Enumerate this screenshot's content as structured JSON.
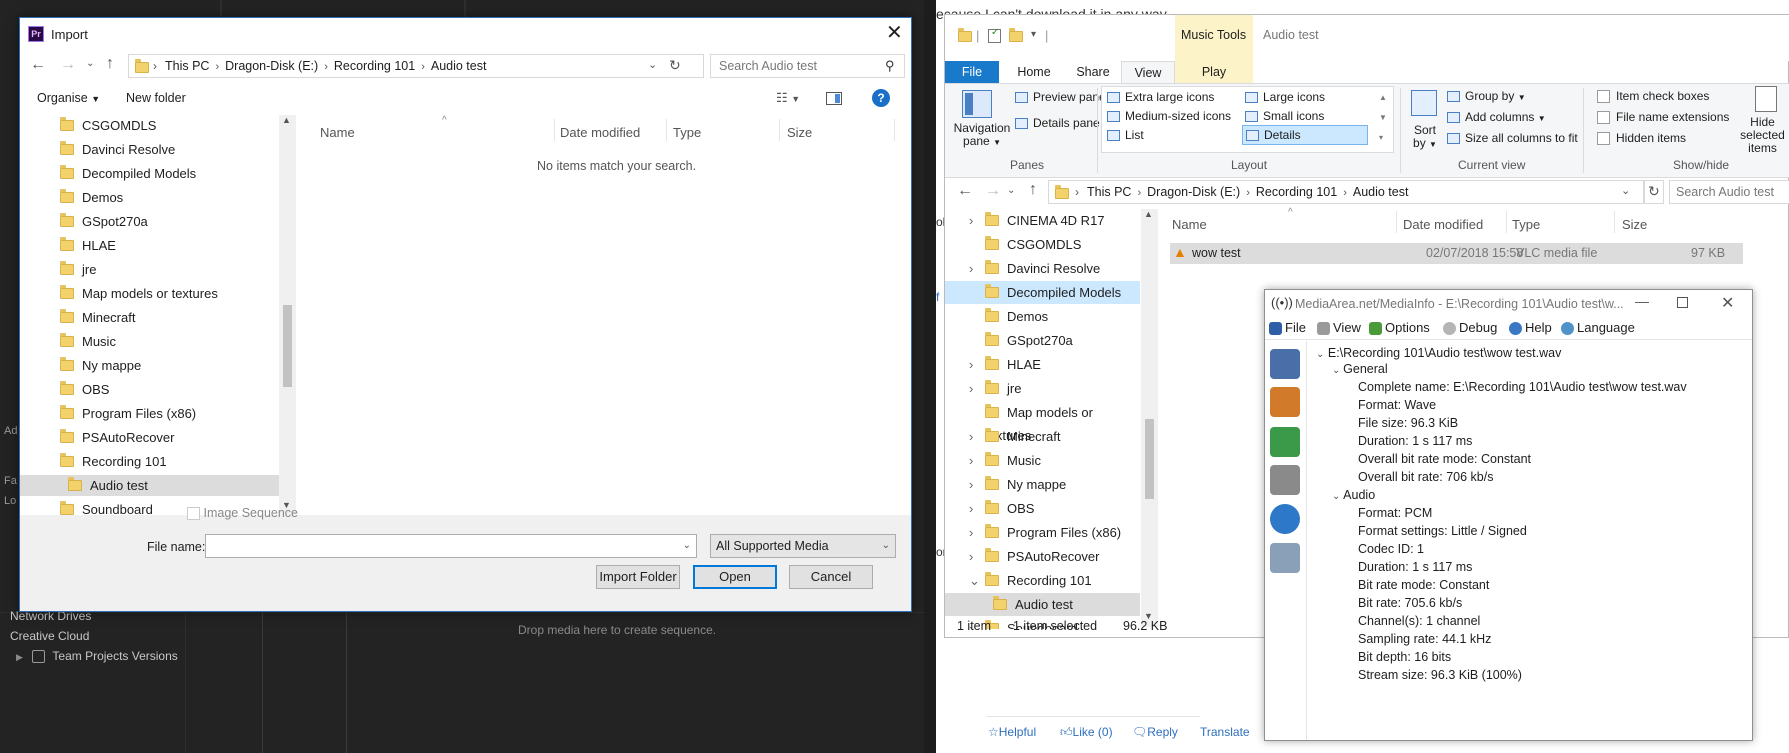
{
  "premiere": {
    "sidebar_items": [
      "Network Drives",
      "Creative Cloud",
      "Team Projects Versions"
    ],
    "drop_hint": "Drop media here to create sequence.",
    "left_fragments": [
      "Fa",
      "Lo",
      "Ad"
    ]
  },
  "web": {
    "header_fragment": "ecause I can't download it in any way",
    "actions": {
      "helpful": "Helpful",
      "like": "Like (0)",
      "reply": "Reply",
      "translate": "Translate"
    },
    "left_fragments": [
      "ol",
      "f",
      "or"
    ]
  },
  "import_dialog": {
    "title": "Import",
    "logo": "Pr",
    "breadcrumb": [
      "This PC",
      "Dragon-Disk (E:)",
      "Recording 101",
      "Audio test"
    ],
    "search_placeholder": "Search Audio test",
    "toolbar": {
      "organise": "Organise",
      "new_folder": "New folder",
      "help": "?"
    },
    "folders": [
      "CSGOMDLS",
      "Davinci Resolve",
      "Decompiled Models",
      "Demos",
      "GSpot270a",
      "HLAE",
      "jre",
      "Map models or textures",
      "Minecraft",
      "Music",
      "Ny mappe",
      "OBS",
      "Program Files (x86)",
      "PSAutoRecover",
      "Recording 101",
      "Audio test",
      "Soundboard"
    ],
    "selected_folder": "Audio test",
    "columns": [
      "Name",
      "Date modified",
      "Type",
      "Size"
    ],
    "empty_message": "No items match your search.",
    "image_sequence_label": "Image Sequence",
    "file_name_label": "File name:",
    "file_name_value": "",
    "file_type": "All Supported Media",
    "buttons": {
      "import_folder": "Import Folder",
      "open": "Open",
      "cancel": "Cancel"
    }
  },
  "explorer": {
    "context_tab": "Music Tools",
    "window_title": "Audio test",
    "tabs": [
      "File",
      "Home",
      "Share",
      "View",
      "Play"
    ],
    "active_tab": "View",
    "ribbon": {
      "panes": {
        "navigation_pane": "Navigation pane",
        "preview_pane": "Preview pane",
        "details_pane": "Details pane",
        "group": "Panes"
      },
      "layout": {
        "items": [
          "Extra large icons",
          "Large icons",
          "Medium-sized icons",
          "Small icons",
          "List",
          "Details"
        ],
        "selected": "Details",
        "group": "Layout"
      },
      "current_view": {
        "sort_by": "Sort by",
        "group_by": "Group by",
        "add_columns": "Add columns",
        "size_all": "Size all columns to fit",
        "group": "Current view"
      },
      "show_hide": {
        "item_check_boxes": "Item check boxes",
        "file_name_extensions": "File name extensions",
        "hidden_items": "Hidden items",
        "hide_selected": "Hide selected items",
        "group": "Show/hide"
      }
    },
    "breadcrumb": [
      "This PC",
      "Dragon-Disk (E:)",
      "Recording 101",
      "Audio test"
    ],
    "search_placeholder": "Search Audio test",
    "tree": [
      {
        "label": "CINEMA 4D R17",
        "expandable": true
      },
      {
        "label": "CSGOMDLS",
        "expandable": false
      },
      {
        "label": "Davinci Resolve",
        "expandable": true
      },
      {
        "label": "Decompiled Models",
        "expandable": false
      },
      {
        "label": "Demos",
        "expandable": false
      },
      {
        "label": "GSpot270a",
        "expandable": false
      },
      {
        "label": "HLAE",
        "expandable": true
      },
      {
        "label": "jre",
        "expandable": true
      },
      {
        "label": "Map models or textures",
        "expandable": false
      },
      {
        "label": "Minecraft",
        "expandable": true
      },
      {
        "label": "Music",
        "expandable": true
      },
      {
        "label": "Ny mappe",
        "expandable": true
      },
      {
        "label": "OBS",
        "expandable": true
      },
      {
        "label": "Program Files (x86)",
        "expandable": true
      },
      {
        "label": "PSAutoRecover",
        "expandable": true
      },
      {
        "label": "Recording 101",
        "expandable": true
      },
      {
        "label": "Audio test",
        "expandable": false
      },
      {
        "label": "Soundboard",
        "expandable": true
      }
    ],
    "columns": [
      "Name",
      "Date modified",
      "Type",
      "Size"
    ],
    "files": [
      {
        "name": "wow test",
        "date": "02/07/2018 15:58",
        "type": "VLC media file",
        "size": "97 KB"
      }
    ],
    "status": {
      "count": "1 item",
      "selected": "1 item selected",
      "size": "96.2 KB"
    }
  },
  "mediainfo": {
    "title": "MediaArea.net/MediaInfo - E:\\Recording 101\\Audio test\\w...",
    "menu": [
      "File",
      "View",
      "Options",
      "Debug",
      "Help",
      "Language"
    ],
    "root": "E:\\Recording 101\\Audio test\\wow test.wav",
    "sections": [
      {
        "name": "General",
        "fields": [
          "Complete name: E:\\Recording 101\\Audio test\\wow test.wav",
          "Format: Wave",
          "File size: 96.3 KiB",
          "Duration: 1 s 117 ms",
          "Overall bit rate mode: Constant",
          "Overall bit rate: 706 kb/s"
        ]
      },
      {
        "name": "Audio",
        "fields": [
          "Format: PCM",
          "Format settings: Little / Signed",
          "Codec ID: 1",
          "Duration: 1 s 117 ms",
          "Bit rate mode: Constant",
          "Bit rate: 705.6 kb/s",
          "Channel(s): 1 channel",
          "Sampling rate: 44.1 kHz",
          "Bit depth: 16 bits",
          "Stream size: 96.3 KiB (100%)"
        ]
      }
    ]
  }
}
